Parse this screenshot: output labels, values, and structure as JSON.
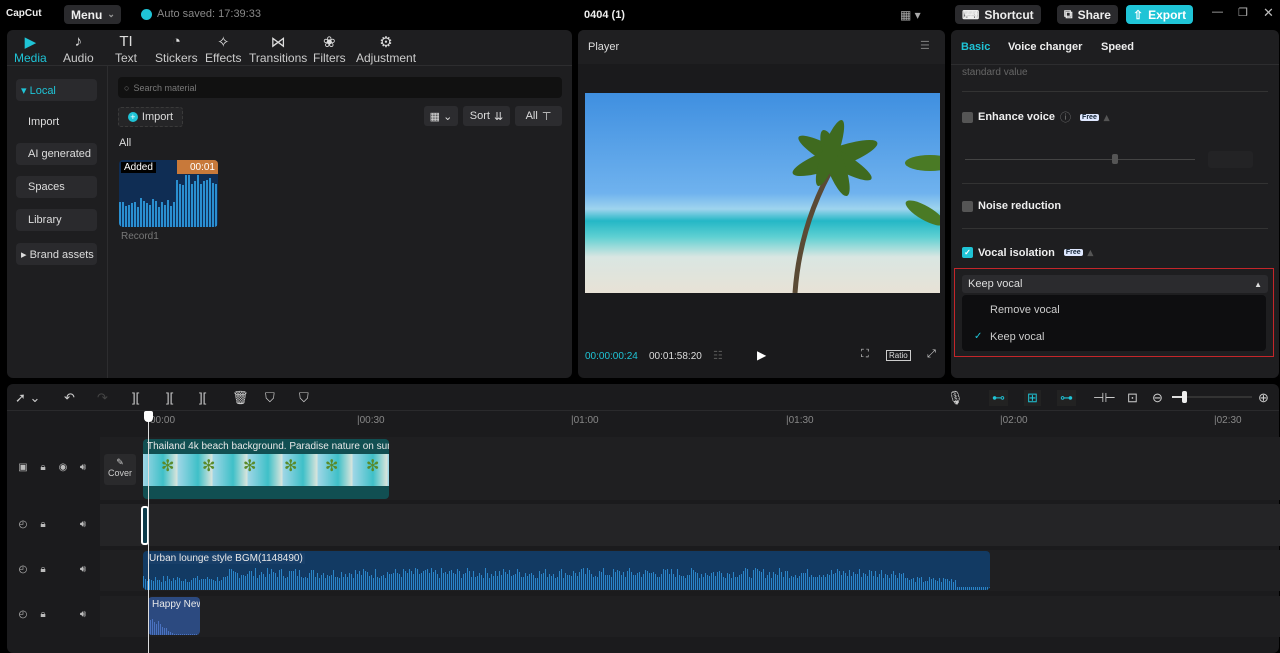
{
  "app": {
    "logo": "CapCut",
    "menu": "Menu",
    "autosave": "Auto saved: 17:39:33",
    "project": "0404 (1)",
    "shortcut": "Shortcut",
    "share": "Share",
    "export": "Export",
    "accent": "#1fc4d6"
  },
  "media_tabs": [
    {
      "icon": "▶",
      "label": "Media"
    },
    {
      "icon": "♪",
      "label": "Audio"
    },
    {
      "icon": "TI",
      "label": "Text"
    },
    {
      "icon": "◔",
      "label": "Stickers"
    },
    {
      "icon": "✧",
      "label": "Effects"
    },
    {
      "icon": "⋈",
      "label": "Transitions"
    },
    {
      "icon": "❀",
      "label": "Filters"
    },
    {
      "icon": "⚙",
      "label": "Adjustment"
    }
  ],
  "sidebar": [
    "▾ Local",
    "Import",
    "AI generated",
    "Spaces",
    "Library",
    "▸ Brand assets"
  ],
  "library": {
    "search_placeholder": "Search material",
    "import": "Import",
    "sort": "Sort",
    "all_filter": "All",
    "section": "All",
    "item": {
      "badge": "Added",
      "duration": "00:01",
      "name": "Record1"
    }
  },
  "player": {
    "title": "Player",
    "current": "00:00:00:24",
    "total": "00:01:58:20",
    "ratio": "Ratio"
  },
  "inspector": {
    "tabs": [
      "Basic",
      "Voice changer",
      "Speed"
    ],
    "hint": "standard value",
    "enhance": "Enhance voice",
    "noise": "Noise reduction",
    "vocal": "Vocal isolation",
    "free": "Free",
    "enhance_level": 0.65,
    "dropdown": {
      "selected": "Keep vocal",
      "options": [
        "Remove vocal",
        "Keep vocal"
      ]
    }
  },
  "timeline": {
    "ticks": [
      "00:00",
      "|00:30",
      "|01:00",
      "|01:30",
      "|02:00",
      "|02:30"
    ],
    "cover": "Cover",
    "clips": {
      "video": "Thailand 4k beach background. Paradise nature on sun",
      "bgm": "Urban lounge style BGM(1148490)",
      "sfx": "Happy New"
    }
  }
}
